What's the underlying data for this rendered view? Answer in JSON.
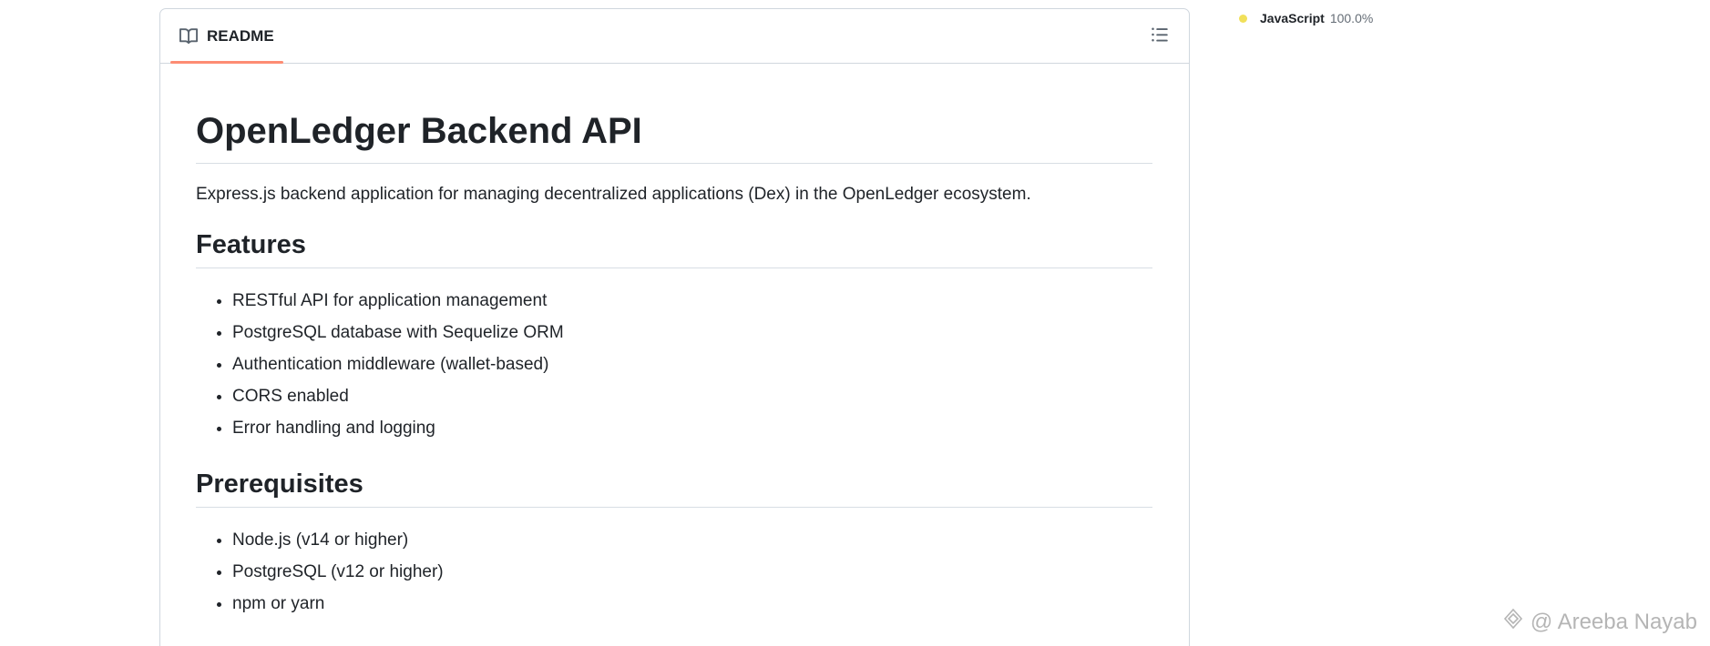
{
  "readme": {
    "tab_label": "README",
    "title": "OpenLedger Backend API",
    "description": "Express.js backend application for managing decentralized applications (Dex) in the OpenLedger ecosystem.",
    "sections": {
      "features": {
        "heading": "Features",
        "items": [
          "RESTful API for application management",
          "PostgreSQL database with Sequelize ORM",
          "Authentication middleware (wallet-based)",
          "CORS enabled",
          "Error handling and logging"
        ]
      },
      "prerequisites": {
        "heading": "Prerequisites",
        "items": [
          "Node.js (v14 or higher)",
          "PostgreSQL (v12 or higher)",
          "npm or yarn"
        ]
      }
    }
  },
  "languages": [
    {
      "name": "JavaScript",
      "percent": "100.0%",
      "color": "#f1e05a"
    }
  ],
  "watermark": {
    "text": "@ Areeba Nayab"
  },
  "icons": {
    "readme_tab": "book-icon",
    "outline": "list-unordered-icon",
    "watermark": "logo-icon"
  }
}
